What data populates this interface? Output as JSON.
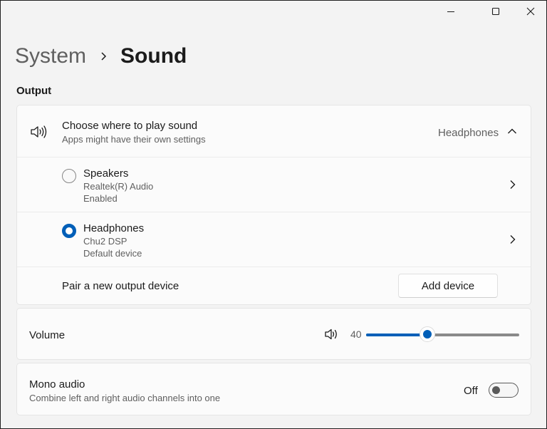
{
  "window": {
    "controls": [
      "minimize-icon",
      "maximize-icon",
      "close-icon"
    ]
  },
  "breadcrumb": {
    "parent": "System",
    "separator_icon": "chevron-right-icon",
    "current": "Sound"
  },
  "output": {
    "section_title": "Output",
    "choose": {
      "icon": "speaker-icon",
      "title": "Choose where to play sound",
      "subtitle": "Apps might have their own settings",
      "selected_value": "Headphones",
      "expand_icon": "chevron-up-icon"
    },
    "devices": [
      {
        "name": "Speakers",
        "driver": "Realtek(R) Audio",
        "status": "Enabled",
        "selected": false
      },
      {
        "name": "Headphones",
        "driver": "Chu2 DSP",
        "status": "Default device",
        "selected": true
      }
    ],
    "pair": {
      "label": "Pair a new output device",
      "button_label": "Add device"
    }
  },
  "volume": {
    "label": "Volume",
    "icon": "speaker-icon",
    "value_text": "40",
    "level": 0.4,
    "accent": "#005fb8"
  },
  "mono_audio": {
    "title": "Mono audio",
    "subtitle": "Combine left and right audio channels into one",
    "state_label": "Off",
    "on": false
  }
}
